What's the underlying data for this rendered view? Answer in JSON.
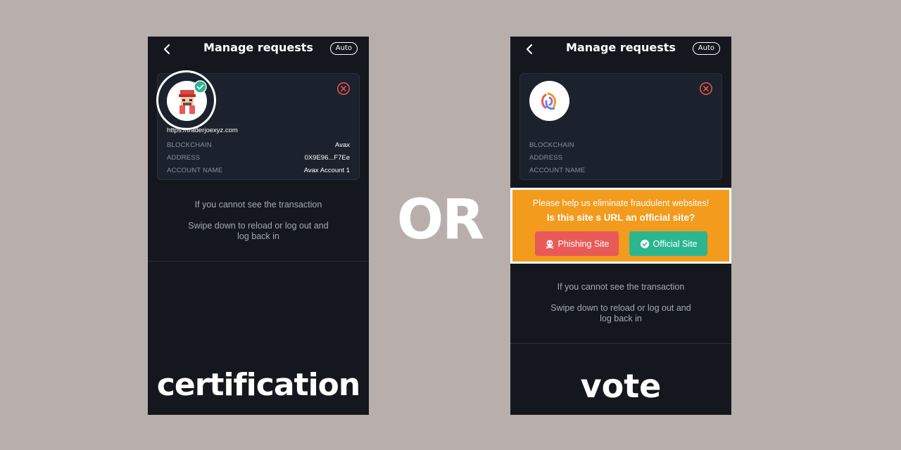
{
  "separator": "OR",
  "left": {
    "header": {
      "title": "Manage requests",
      "auto_label": "Auto"
    },
    "card": {
      "url": "https://traderjoexyz.com",
      "rows": [
        {
          "label": "BLOCKCHAIN",
          "value": "Avax"
        },
        {
          "label": "ADDRESS",
          "value": "0X9E96...F7Ee"
        },
        {
          "label": "ACCOUNT NAME",
          "value": "Avax Account 1"
        }
      ]
    },
    "message": {
      "line1": "If you cannot see the transaction",
      "line2": "Swipe down to reload or log out and log back in"
    },
    "caption": "certification"
  },
  "right": {
    "header": {
      "title": "Manage requests",
      "auto_label": "Auto"
    },
    "card": {
      "rows": [
        {
          "label": "BLOCKCHAIN",
          "value": ""
        },
        {
          "label": "ADDRESS",
          "value": ""
        },
        {
          "label": "ACCOUNT NAME",
          "value": ""
        }
      ]
    },
    "vote": {
      "prompt": "Please help us eliminate fraudulent websites!",
      "question": "Is this site s URL an official site?",
      "phishing_label": "Phishing Site",
      "official_label": "Official Site"
    },
    "message": {
      "line1": "If you cannot see the transaction",
      "line2": "Swipe down to reload or log out and log back in"
    },
    "caption": "vote"
  },
  "colors": {
    "background": "#b8afac",
    "phone_bg": "#14171e",
    "card_bg": "#1b222d",
    "close_red": "#e5534b",
    "verified_green": "#2bb68f",
    "vote_orange": "#f29b1d",
    "phishing_red": "#e85a57",
    "official_green": "#2bb68f"
  },
  "icons": {
    "back": "chevron-left-icon",
    "close": "close-circle-icon",
    "verified": "check-badge-icon",
    "phishing": "skull-icon",
    "official": "check-circle-icon"
  }
}
